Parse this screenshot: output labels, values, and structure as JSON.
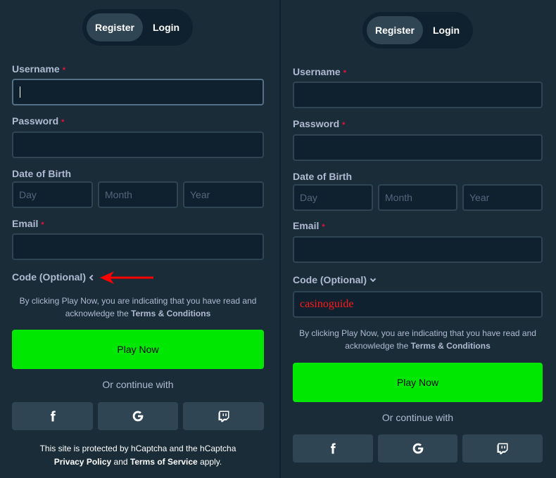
{
  "left": {
    "tabs": {
      "register": "Register",
      "login": "Login"
    },
    "fields": {
      "username_label": "Username",
      "password_label": "Password",
      "dob_label": "Date of Birth",
      "day_placeholder": "Day",
      "month_placeholder": "Month",
      "year_placeholder": "Year",
      "email_label": "Email",
      "required_mark": "*"
    },
    "code_label": "Code (Optional)",
    "terms_text": "By clicking Play Now, you are indicating that you have read and acknowledge the",
    "terms_link": "Terms & Conditions",
    "play_label": "Play Now",
    "or_text": "Or continue with",
    "footer": {
      "line1": "This site is protected by hCaptcha and the hCaptcha",
      "privacy": "Privacy Policy",
      "and": "and",
      "tos": "Terms of Service",
      "apply": "apply."
    }
  },
  "right": {
    "tabs": {
      "register": "Register",
      "login": "Login"
    },
    "fields": {
      "username_label": "Username",
      "password_label": "Password",
      "dob_label": "Date of Birth",
      "day_placeholder": "Day",
      "month_placeholder": "Month",
      "year_placeholder": "Year",
      "email_label": "Email",
      "required_mark": "*"
    },
    "code_label": "Code (Optional)",
    "code_value": "casinoguide",
    "terms_text": "By clicking Play Now, you are indicating that you have read and acknowledge the",
    "terms_link": "Terms & Conditions",
    "play_label": "Play Now",
    "or_text": "Or continue with"
  },
  "colors": {
    "background": "#1a2c38",
    "input_bg": "#0f212e",
    "button_green": "#00e701",
    "required_red": "#e9113c",
    "arrow_red": "#ff0000"
  },
  "icons": [
    "facebook-icon",
    "google-icon",
    "twitch-icon",
    "chevron-left-icon",
    "chevron-down-icon",
    "red-arrow-annotation"
  ]
}
